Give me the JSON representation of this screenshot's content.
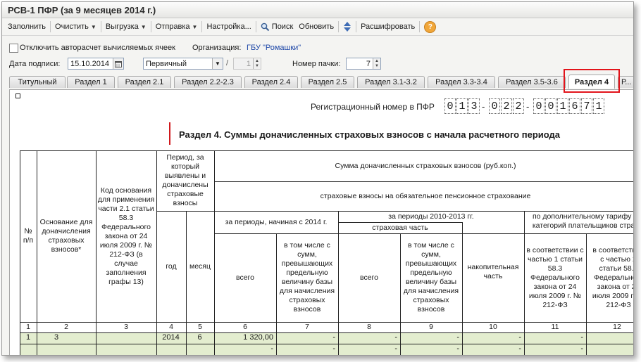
{
  "window": {
    "title": "РСВ-1 ПФР (за 9 месяцев 2014 г.)"
  },
  "toolbar": {
    "fill": "Заполнить",
    "clear": "Очистить",
    "export": "Выгрузка",
    "send": "Отправка",
    "settings": "Настройка...",
    "search": "Поиск",
    "refresh": "Обновить",
    "decode": "Расшифровать",
    "help": "?"
  },
  "form": {
    "autocalc_label": "Отключить авторасчет вычисляемых ячеек",
    "org_label": "Организация:",
    "org_value": "ГБУ \"Ромашки\"",
    "sign_date_label": "Дата подписи:",
    "sign_date_value": "15.10.2014",
    "type_value": "Первичный",
    "slash": "/",
    "correction_number": "1",
    "pack_label": "Номер пачки:",
    "pack_value": "7"
  },
  "tabs": [
    "Титульный",
    "Раздел 1",
    "Раздел 2.1",
    "Раздел 2.2-2.3",
    "Раздел 2.4",
    "Раздел 2.5",
    "Раздел 3.1-3.2",
    "Раздел 3.3-3.4",
    "Раздел 3.5-3.6",
    "Раздел 4",
    "Р..."
  ],
  "active_tab": "Раздел 4",
  "report": {
    "reg_label": "Регистрационный номер в ПФР",
    "reg_digits": [
      "0",
      "1",
      "3",
      "0",
      "2",
      "2",
      "0",
      "0",
      "1",
      "6",
      "7",
      "1"
    ],
    "dash": "-",
    "title": "Раздел 4. Суммы доначисленных страховых взносов с начала расчетного периода"
  },
  "table": {
    "h_num": "№ п/п",
    "h_basis": "Основание для доначисления страховых взносов*",
    "h_code": "Код основания для применения части 2.1 статьи 58.3 Федерального закона от 24 июля 2009 г. № 212-ФЗ (в случае заполнения графы 13)",
    "h_period": "Период, за который выявлены и доначислены страховые взносы",
    "h_year": "год",
    "h_month": "месяц",
    "h_sum": "Сумма доначисленных страховых взносов (руб.коп.)",
    "h_pension": "страховые взносы на обязательное пенсионное страхование",
    "h_since2014": "за периоды, начиная с 2014 г.",
    "h_2010_2013": "за периоды 2010-2013 гг.",
    "h_insurance_part": "страховая часть",
    "h_additional": "по дополнительному тарифу для отдельных категорий плательщиков страховых взносов",
    "h_total": "всего",
    "h_including": "в том числе с сумм, превышающих предельную величину базы для начисления страховых взносов",
    "h_funded": "накопительная часть",
    "h_part1": "в соответствии с частью 1 статьи 58.3 Федерального закона от 24 июля 2009 г. № 212-ФЗ",
    "h_part2": "в соответствии с частью 2 статьи 58.3 Федерального закона от 24 июля 2009 г. № 212-ФЗ",
    "col_numbers": [
      "1",
      "2",
      "3",
      "4",
      "5",
      "6",
      "7",
      "8",
      "9",
      "10",
      "11",
      "12"
    ],
    "rows": [
      {
        "num": "1",
        "basis": "3",
        "code": "",
        "year": "2014",
        "month": "6",
        "c6": "1 320,00",
        "c7": "-",
        "c8": "-",
        "c9": "-",
        "c10": "-",
        "c11": "-",
        "c12": "-"
      },
      {
        "num": "",
        "basis": "",
        "code": "",
        "year": "",
        "month": "",
        "c6": "-",
        "c7": "-",
        "c8": "-",
        "c9": "-",
        "c10": "-",
        "c11": "-",
        "c12": "-"
      }
    ]
  },
  "colors": {
    "highlight": "#e2141b",
    "link": "#1f48a8",
    "row_fill": "#e3edcf"
  }
}
